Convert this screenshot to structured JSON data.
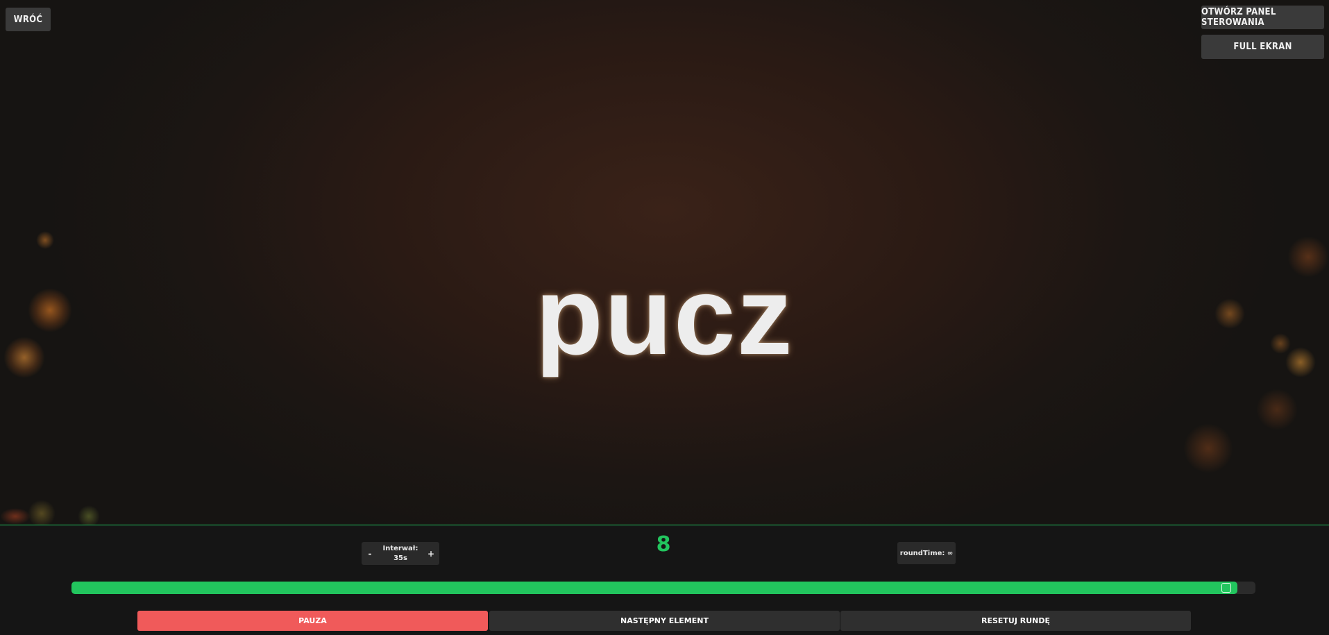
{
  "top_left": {
    "back_label": "WRÓĆ"
  },
  "top_right": {
    "control_panel_label": "OTWÓRZ PANEL STEROWANIA",
    "fullscreen_label": "FULL EKRAN"
  },
  "main": {
    "word": "pucz"
  },
  "controls": {
    "interval": {
      "minus": "-",
      "label": "Interwał:",
      "value": "35s",
      "plus": "+"
    },
    "counter": "8",
    "round_time": "roundTime: ∞",
    "progress_fraction": 0.985,
    "buttons": {
      "pause": "PAUZA",
      "next": "NASTĘPNY ELEMENT",
      "reset": "RESETUJ RUNDĘ"
    }
  },
  "colors": {
    "accent_green": "#22c55e",
    "pause_red": "#f05a5a",
    "button_dark": "#3a3a3a"
  }
}
